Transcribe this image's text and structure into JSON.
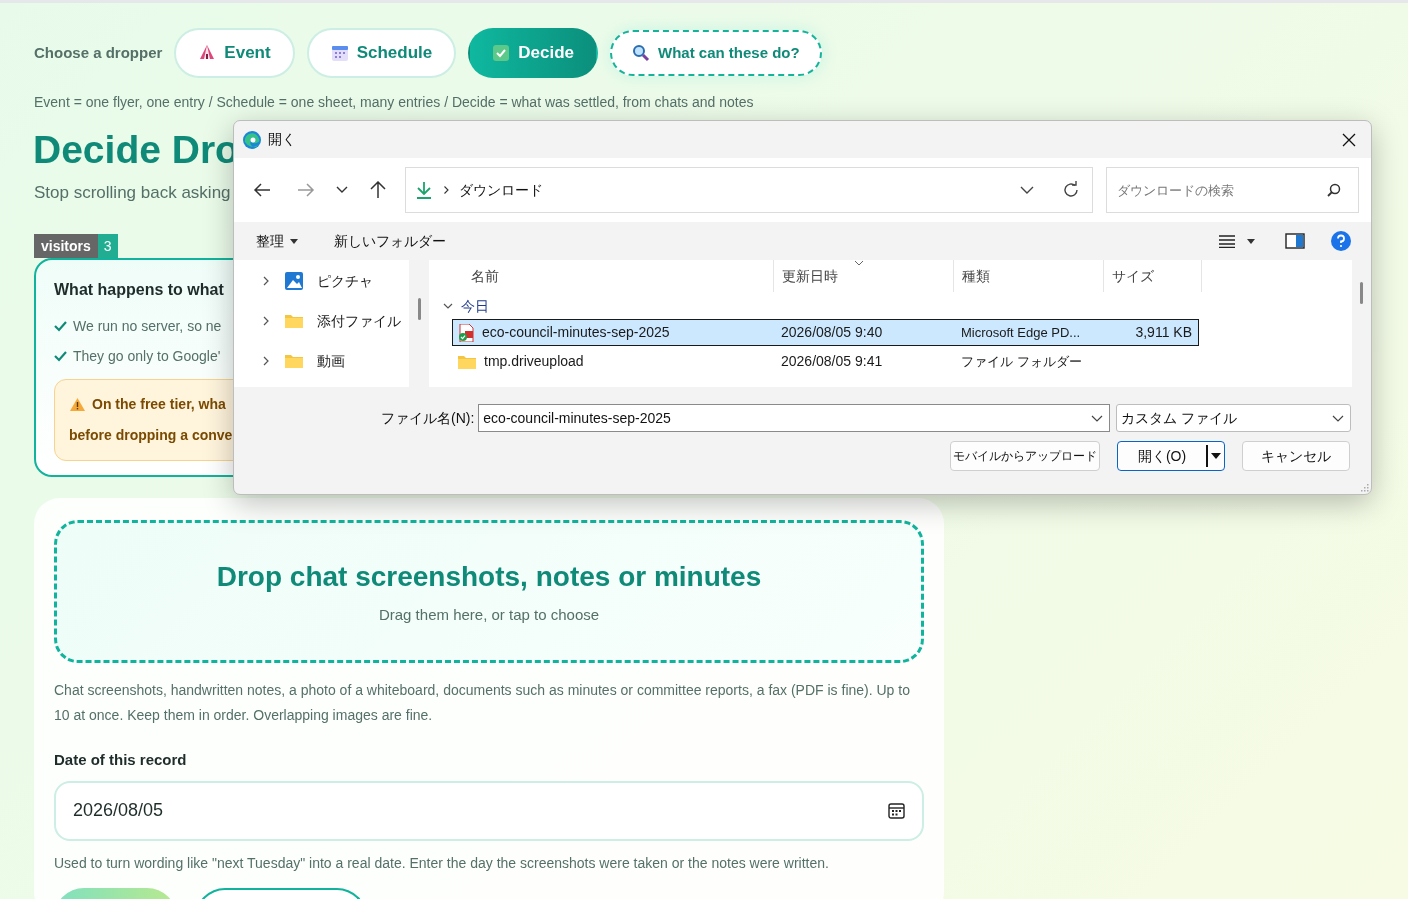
{
  "header": {
    "label": "Choose a dropper",
    "tabs": [
      {
        "label": "Event",
        "kind": "event",
        "selected": false
      },
      {
        "label": "Schedule",
        "kind": "schedule",
        "selected": false
      },
      {
        "label": "Decide",
        "kind": "decide",
        "selected": true
      }
    ],
    "help_button": {
      "label": "What can these do?"
    }
  },
  "legend": "Event = one flyer, one entry / Schedule = one sheet, many entries / Decide = what was settled, from chats and notes",
  "title": "Decide Dro",
  "subtitle": "Stop scrolling back asking",
  "visitors": {
    "label": "visitors",
    "count": "3"
  },
  "privacy_card": {
    "heading": "What happens to what",
    "points": [
      "We run no server, so ne",
      "They go only to Google'"
    ],
    "warning": [
      "On the free tier, wha",
      "before dropping a conve"
    ]
  },
  "dropzone": {
    "title": "Drop chat screenshots, notes or minutes",
    "hint": "Drag them here, or tap to choose"
  },
  "description": "Chat screenshots, handwritten notes, a photo of a whiteboard, documents such as minutes or committee reports, a fax (PDF is fine). Up to 10 at once. Keep them in order. Overlapping images are fine.",
  "date_field": {
    "label": "Date of this record",
    "value": "2026/08/05"
  },
  "date_help": "Used to turn wording like \"next Tuesday\" into a real date. Enter the day the screenshots were taken or the notes were written.",
  "file_dialog": {
    "title": "開く",
    "address": "ダウンロード",
    "search_placeholder": "ダウンロードの検索",
    "toolbar": {
      "organize": "整理",
      "new_folder": "新しいフォルダー"
    },
    "nav_items": [
      {
        "label": "ピクチャ",
        "kind": "pictures",
        "expanded": false
      },
      {
        "label": "添付ファイル",
        "kind": "folder",
        "expanded": false
      },
      {
        "label": "動画",
        "kind": "folder",
        "expanded": false
      }
    ],
    "columns": [
      {
        "label": "名前",
        "sorted": false
      },
      {
        "label": "更新日時",
        "sorted": true
      },
      {
        "label": "種類",
        "sorted": false
      },
      {
        "label": "サイズ",
        "sorted": false
      }
    ],
    "groups": [
      {
        "label": "今日",
        "expanded": true,
        "files": [
          {
            "name": "eco-council-minutes-sep-2025",
            "modified": "2026/08/05 9:40",
            "type": "Microsoft Edge PD...",
            "size": "3,911 KB",
            "kind": "pdf",
            "selected": true
          },
          {
            "name": "tmp.driveupload",
            "modified": "2026/08/05 9:41",
            "type": "ファイル フォルダー",
            "kind": "folder",
            "selected": false
          }
        ]
      }
    ],
    "filename_label": "ファイル名(N):",
    "filename": "eco-council-minutes-sep-2025",
    "filter": "カスタム ファイル",
    "buttons": {
      "upload": "モバイルからアップロード",
      "open": "開く(O)",
      "cancel": "キャンセル"
    }
  }
}
